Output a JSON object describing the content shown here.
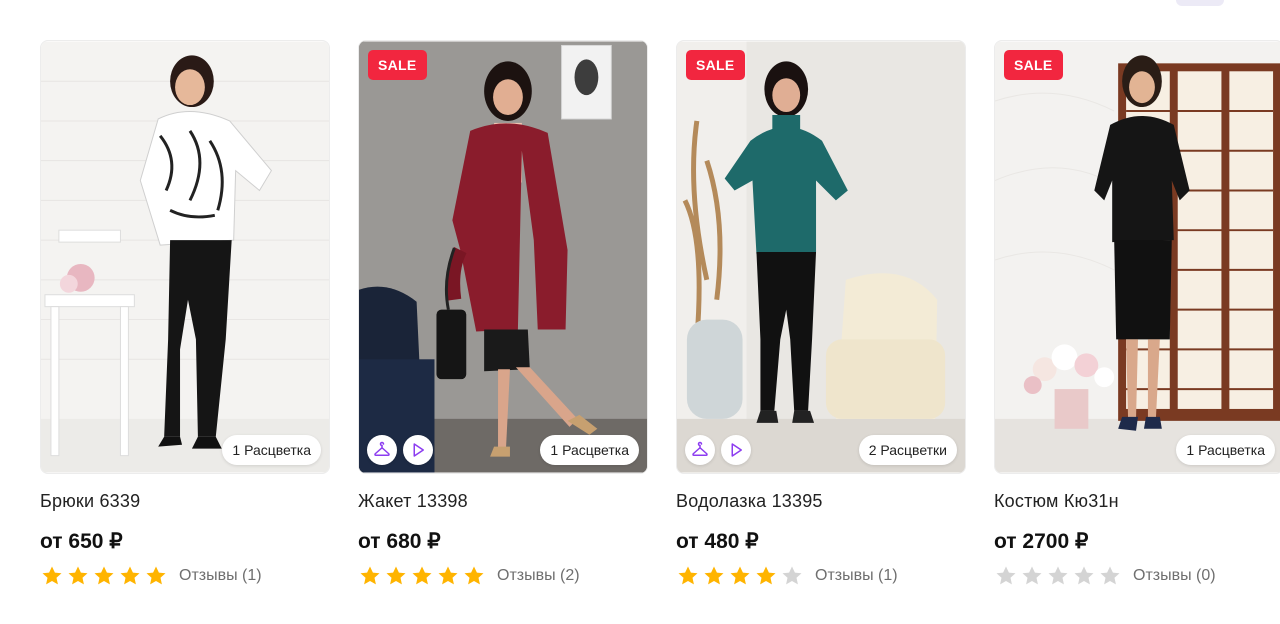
{
  "colors": {
    "sale_badge": "#f2263f",
    "star_filled": "#ffb400",
    "star_empty": "#d4d4d4",
    "badge_icon": "#8c3cf0"
  },
  "products": [
    {
      "title": "Брюки 6339",
      "price": "от 650 ₽",
      "rating": 5,
      "reviews": "Отзывы (1)",
      "variants": "1 Расцветка",
      "sale": false,
      "sale_label": "",
      "fitting_icon": false,
      "video_icon": false
    },
    {
      "title": "Жакет 13398",
      "price": "от 680 ₽",
      "rating": 5,
      "reviews": "Отзывы (2)",
      "variants": "1 Расцветка",
      "sale": true,
      "sale_label": "SALE",
      "fitting_icon": true,
      "video_icon": true
    },
    {
      "title": "Водолазка 13395",
      "price": "от 480 ₽",
      "rating": 4,
      "reviews": "Отзывы (1)",
      "variants": "2 Расцветки",
      "sale": true,
      "sale_label": "SALE",
      "fitting_icon": true,
      "video_icon": true
    },
    {
      "title": "Костюм Кю31н",
      "price": "от 2700 ₽",
      "rating": 0,
      "reviews": "Отзывы (0)",
      "variants": "1 Расцветка",
      "sale": true,
      "sale_label": "SALE",
      "fitting_icon": false,
      "video_icon": false
    }
  ]
}
